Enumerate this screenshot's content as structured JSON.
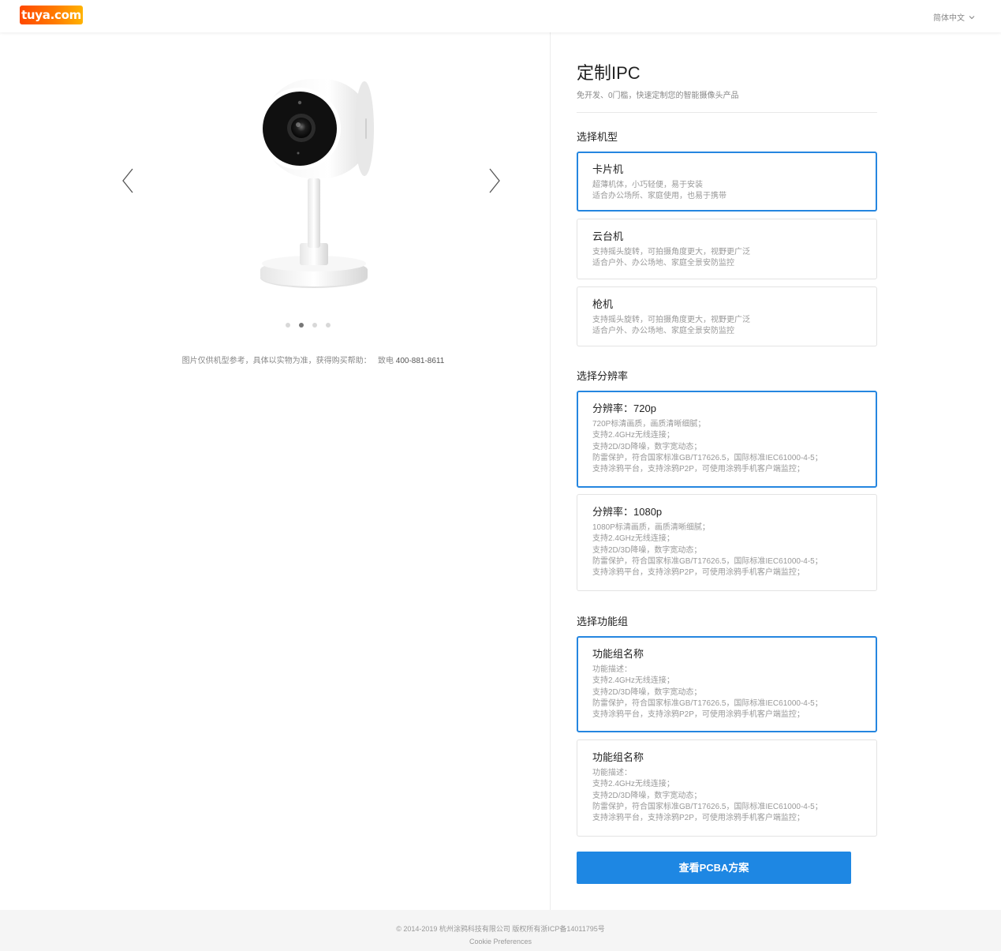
{
  "header": {
    "logo_text": "tuya.com",
    "language": "简体中文"
  },
  "gallery": {
    "note": "图片仅供机型参考，具体以实物为准，获得购买帮助：",
    "phone_prefix": "致电",
    "phone": "400-881-8611",
    "slide_count": 4,
    "active_slide": 2
  },
  "panel": {
    "title": "定制IPC",
    "subtitle": "免开发、0门槛，快速定制您的智能摄像头产品",
    "model_section": {
      "title": "选择机型",
      "options": [
        {
          "title": "卡片机",
          "desc": "超薄机体，小巧轻便，易于安装\n适合办公场所、家庭使用，也易于携带",
          "selected": true
        },
        {
          "title": "云台机",
          "desc": "支持摇头旋转，可拍摄角度更大，视野更广泛\n适合户外、办公场地、家庭全景安防监控",
          "selected": false
        },
        {
          "title": "枪机",
          "desc": "支持摇头旋转，可拍摄角度更大，视野更广泛\n适合户外、办公场地、家庭全景安防监控",
          "selected": false
        }
      ]
    },
    "resolution_section": {
      "title": "选择分辨率",
      "options": [
        {
          "title": "分辨率：720p",
          "desc": "720P标清画质，画质清晰细腻；\n支持2.4GHz无线连接；\n支持2D/3D降噪，数字宽动态；\n防雷保护，符合国家标准GB/T17626.5，国际标准IEC61000-4-5；\n支持涂鸦平台，支持涂鸦P2P，可使用涂鸦手机客户端监控；",
          "selected": true
        },
        {
          "title": "分辨率：1080p",
          "desc": "1080P标清画质，画质清晰细腻；\n支持2.4GHz无线连接；\n支持2D/3D降噪，数字宽动态；\n防雷保护，符合国家标准GB/T17626.5，国际标准IEC61000-4-5；\n支持涂鸦平台，支持涂鸦P2P，可使用涂鸦手机客户端监控；",
          "selected": false
        }
      ]
    },
    "feature_section": {
      "title": "选择功能组",
      "options": [
        {
          "title": "功能组名称",
          "desc": "功能描述：\n支持2.4GHz无线连接；\n支持2D/3D降噪，数字宽动态；\n防雷保护，符合国家标准GB/T17626.5，国际标准IEC61000-4-5；\n支持涂鸦平台，支持涂鸦P2P，可使用涂鸦手机客户端监控；",
          "selected": true
        },
        {
          "title": "功能组名称",
          "desc": "功能描述：\n支持2.4GHz无线连接；\n支持2D/3D降噪，数字宽动态；\n防雷保护，符合国家标准GB/T17626.5，国际标准IEC61000-4-5；\n支持涂鸦平台，支持涂鸦P2P，可使用涂鸦手机客户端监控；",
          "selected": false
        }
      ]
    },
    "cta_label": "查看PCBA方案"
  },
  "footer": {
    "copyright": "© 2014-2019 杭州涂鸦科技有限公司 版权所有浙ICP备14011795号",
    "cookie": "Cookie Preferences"
  },
  "colors": {
    "accent": "#1e87e3",
    "selected_border": "#2586e0",
    "logo_gradient_start": "#ff4800",
    "logo_gradient_end": "#ffb300"
  }
}
